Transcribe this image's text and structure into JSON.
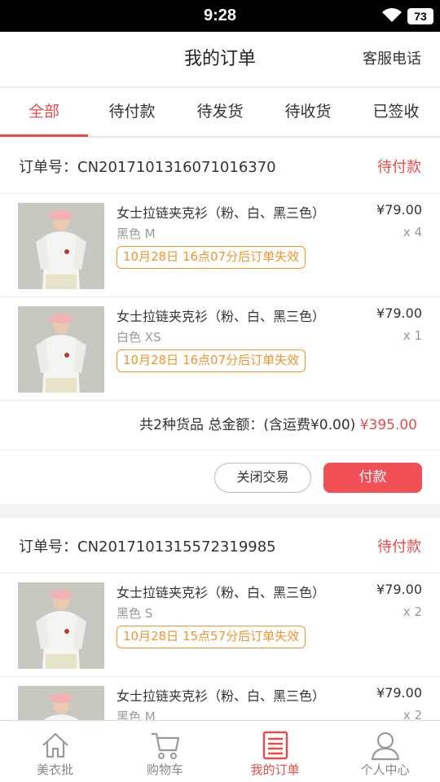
{
  "status_bar": {
    "time": "9:28",
    "battery": "73"
  },
  "header": {
    "title": "我的订单",
    "action": "客服电话"
  },
  "tabs": [
    {
      "label": "全部",
      "active": true
    },
    {
      "label": "待付款",
      "active": false
    },
    {
      "label": "待发货",
      "active": false
    },
    {
      "label": "待收货",
      "active": false
    },
    {
      "label": "已签收",
      "active": false
    }
  ],
  "orders": [
    {
      "number": "订单号：CN2017101316071016370",
      "status": "待付款",
      "items": [
        {
          "name": "女士拉链夹克衫（粉、白、黑三色）",
          "spec": "黑色  M",
          "deadline": "10月28日 16点07分后订单失效",
          "price": "¥79.00",
          "qty": "x 4"
        },
        {
          "name": "女士拉链夹克衫（粉、白、黑三色）",
          "spec": "白色  XS",
          "deadline": "10月28日 16点07分后订单失效",
          "price": "¥79.00",
          "qty": "x 1"
        }
      ],
      "summary_prefix": "共2种货品 总金额：(含运费¥0.00) ",
      "summary_total": "¥395.00",
      "close_label": "关闭交易",
      "pay_label": "付款"
    },
    {
      "number": "订单号：CN2017101315572319985",
      "status": "待付款",
      "items": [
        {
          "name": "女士拉链夹克衫（粉、白、黑三色）",
          "spec": "黑色  S",
          "deadline": "10月28日 15点57分后订单失效",
          "price": "¥79.00",
          "qty": "x 2"
        },
        {
          "name": "女士拉链夹克衫（粉、白、黑三色）",
          "spec": "黑色  M",
          "price": "¥79.00",
          "qty": "x 2"
        }
      ]
    }
  ],
  "bottom_nav": [
    {
      "label": "美衣批",
      "icon": "home-icon",
      "active": false
    },
    {
      "label": "购物车",
      "icon": "cart-icon",
      "active": false
    },
    {
      "label": "我的订单",
      "icon": "order-list-icon",
      "active": true
    },
    {
      "label": "个人中心",
      "icon": "user-icon",
      "active": false
    }
  ],
  "colors": {
    "accent": "#e84b4b",
    "warning": "#f0962e",
    "pay_button": "#f25057"
  }
}
